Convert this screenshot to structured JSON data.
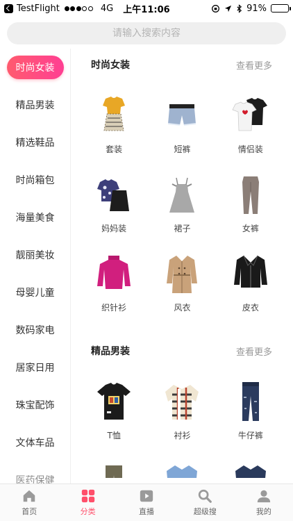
{
  "status_bar": {
    "back_app": "TestFlight",
    "network": "4G",
    "time": "上午11:06",
    "battery": "91%",
    "battery_level": 0.91
  },
  "search": {
    "placeholder": "请输入搜索内容"
  },
  "sidebar": {
    "items": [
      {
        "label": "时尚女装",
        "active": true
      },
      {
        "label": "精品男装"
      },
      {
        "label": "精选鞋品"
      },
      {
        "label": "时尚箱包"
      },
      {
        "label": "海量美食"
      },
      {
        "label": "靓丽美妆"
      },
      {
        "label": "母婴儿童"
      },
      {
        "label": "数码家电"
      },
      {
        "label": "居家日用"
      },
      {
        "label": "珠宝配饰"
      },
      {
        "label": "文体车品"
      },
      {
        "label": "医药保健"
      }
    ]
  },
  "sections": [
    {
      "title": "时尚女装",
      "more": "查看更多",
      "items": [
        {
          "label": "套装",
          "icon": "outfit-icon"
        },
        {
          "label": "短裤",
          "icon": "shorts-icon"
        },
        {
          "label": "情侣装",
          "icon": "couple-tshirt-icon"
        },
        {
          "label": "妈妈装",
          "icon": "mom-outfit-icon"
        },
        {
          "label": "裙子",
          "icon": "dress-icon"
        },
        {
          "label": "女裤",
          "icon": "trousers-icon"
        },
        {
          "label": "织针衫",
          "icon": "sweater-icon"
        },
        {
          "label": "风衣",
          "icon": "trench-coat-icon"
        },
        {
          "label": "皮衣",
          "icon": "leather-jacket-icon"
        }
      ]
    },
    {
      "title": "精品男装",
      "more": "查看更多",
      "items": [
        {
          "label": "T恤",
          "icon": "tshirt-icon"
        },
        {
          "label": "衬衫",
          "icon": "shirt-icon"
        },
        {
          "label": "牛仔裤",
          "icon": "jeans-icon"
        }
      ]
    }
  ],
  "tabbar": {
    "items": [
      {
        "label": "首页",
        "icon": "home-icon"
      },
      {
        "label": "分类",
        "icon": "category-icon",
        "active": true
      },
      {
        "label": "直播",
        "icon": "live-icon"
      },
      {
        "label": "超级搜",
        "icon": "search-icon"
      },
      {
        "label": "我的",
        "icon": "profile-icon"
      }
    ]
  },
  "colors": {
    "accent": "#ff4f6a",
    "accent_gradient_end": "#ff3f93",
    "search_bg": "#efefef"
  }
}
